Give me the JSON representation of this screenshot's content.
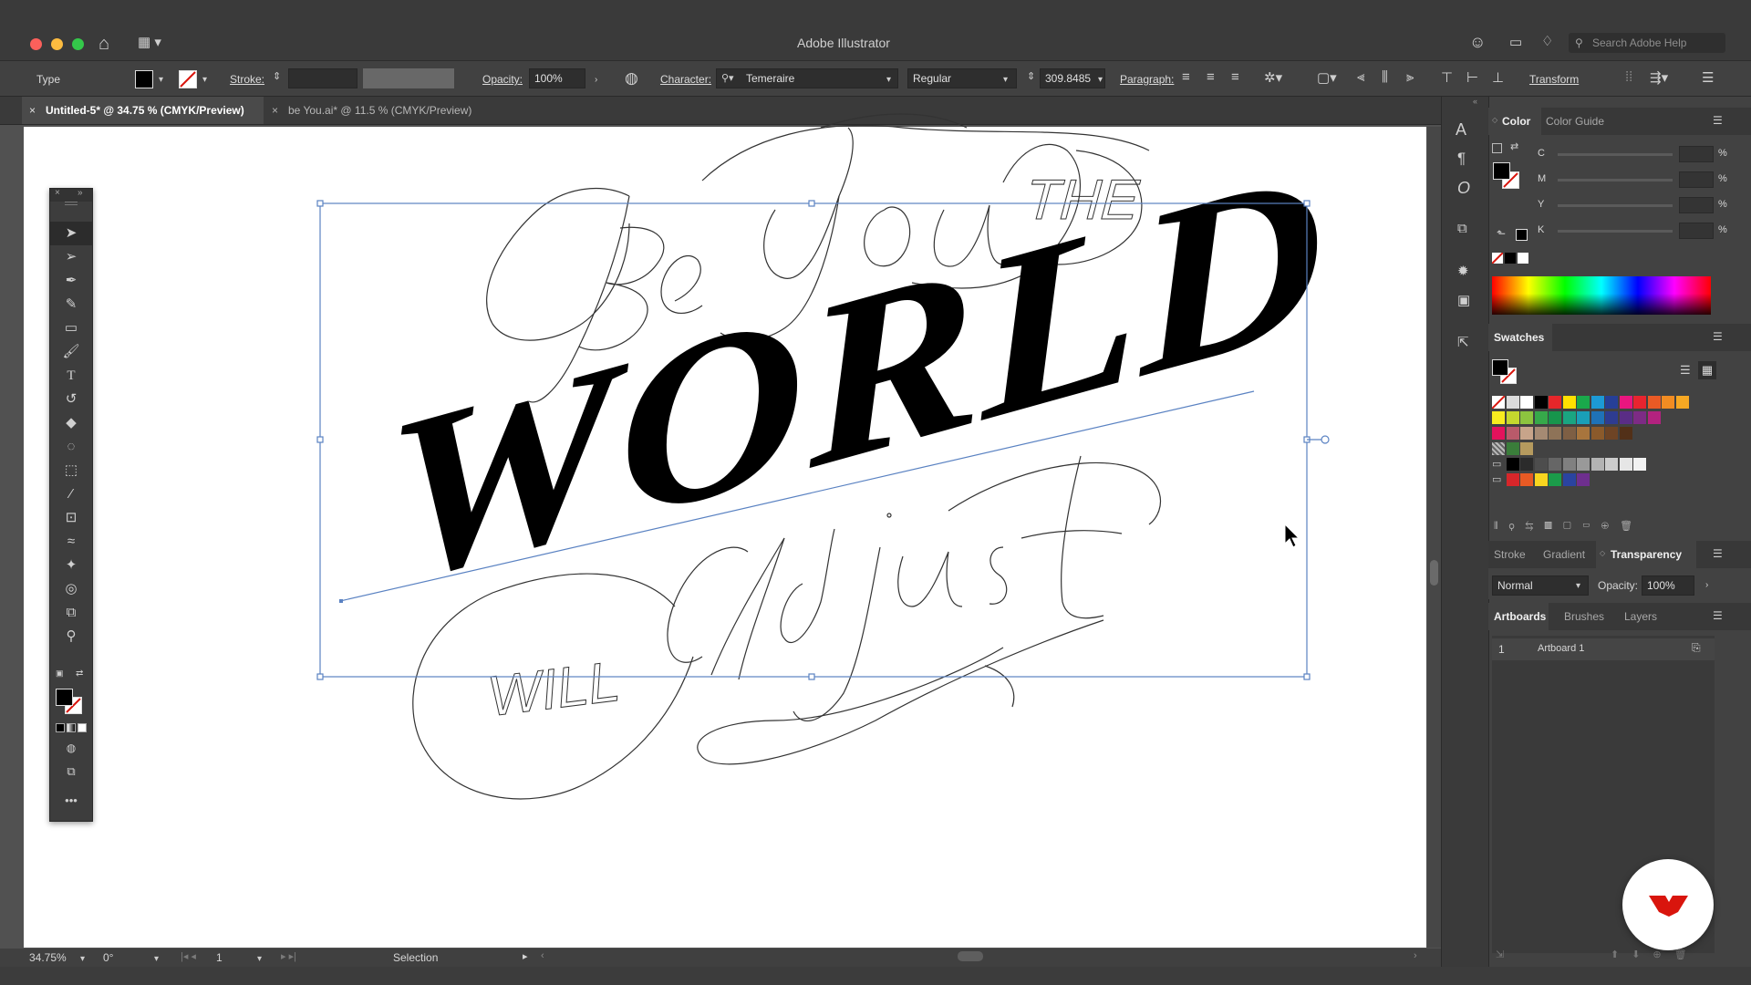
{
  "app": {
    "title": "Adobe Illustrator",
    "search_placeholder": "Search Adobe Help"
  },
  "control_bar": {
    "selection_type": "Type",
    "stroke_label": "Stroke:",
    "opacity_label": "Opacity:",
    "opacity_value": "100%",
    "character_label": "Character:",
    "font_family": "Temeraire",
    "font_style": "Regular",
    "font_size": "309.8485",
    "paragraph_label": "Paragraph:",
    "transform_label": "Transform"
  },
  "tabs": [
    {
      "label": "Untitled-5* @ 34.75 % (CMYK/Preview)",
      "active": true
    },
    {
      "label": "be You.ai* @ 11.5 % (CMYK/Preview)",
      "active": false
    }
  ],
  "artwork": {
    "main_word": "WORLD",
    "words": [
      "Be",
      "You",
      "THE",
      "WILL",
      "Adjust"
    ]
  },
  "status_bar": {
    "zoom": "34.75%",
    "rotation": "0°",
    "artboard_number": "1",
    "tool": "Selection"
  },
  "color_panel": {
    "tabs": [
      "Color",
      "Color Guide"
    ],
    "channels": [
      "C",
      "M",
      "Y",
      "K"
    ],
    "unit": "%"
  },
  "swatches_panel": {
    "title": "Swatches",
    "colors_row1": [
      "#ffffff",
      "#000000",
      "#e6262a",
      "#ffe100",
      "#1aa84b",
      "#1c9ad6",
      "#263f97",
      "#e9167f",
      "#e8242f",
      "#ea5a25",
      "#f28c22",
      "#f7a823"
    ],
    "colors_row2": [
      "#f8ec1f",
      "#c5d82e",
      "#8cc43f",
      "#36a94a",
      "#17954c",
      "#1aa581",
      "#1a9fb7",
      "#1f72b7",
      "#2e3c91",
      "#5a2d86",
      "#7d2b85",
      "#b3227f"
    ],
    "colors_row3": [
      "#e3125c",
      "#b95a6a",
      "#c7a48a",
      "#a58a73",
      "#8e7358",
      "#7e5f44",
      "#a8753d",
      "#8b5a2b",
      "#6e4425",
      "#523018"
    ],
    "grays": [
      "#000000",
      "#2b2b2b",
      "#4d4d4d",
      "#666666",
      "#808080",
      "#999999",
      "#b3b3b3",
      "#cccccc",
      "#e6e6e6",
      "#f2f2f2"
    ],
    "group2": [
      "#d7262a",
      "#e85a24",
      "#f8d51f",
      "#1b9b4a",
      "#2a44a0",
      "#6e2f8e"
    ]
  },
  "lower_tabs": {
    "items": [
      "Stroke",
      "Gradient",
      "Transparency"
    ],
    "active": "Transparency"
  },
  "transparency": {
    "blend_mode": "Normal",
    "opacity_label": "Opacity:",
    "opacity_value": "100%"
  },
  "artboards_panel": {
    "tabs": [
      "Artboards",
      "Brushes",
      "Layers"
    ],
    "rows": [
      {
        "number": "1",
        "name": "Artboard 1"
      }
    ]
  },
  "colors": {
    "selection_blue": "#5a82c2",
    "accent_red": "#d9150d"
  }
}
